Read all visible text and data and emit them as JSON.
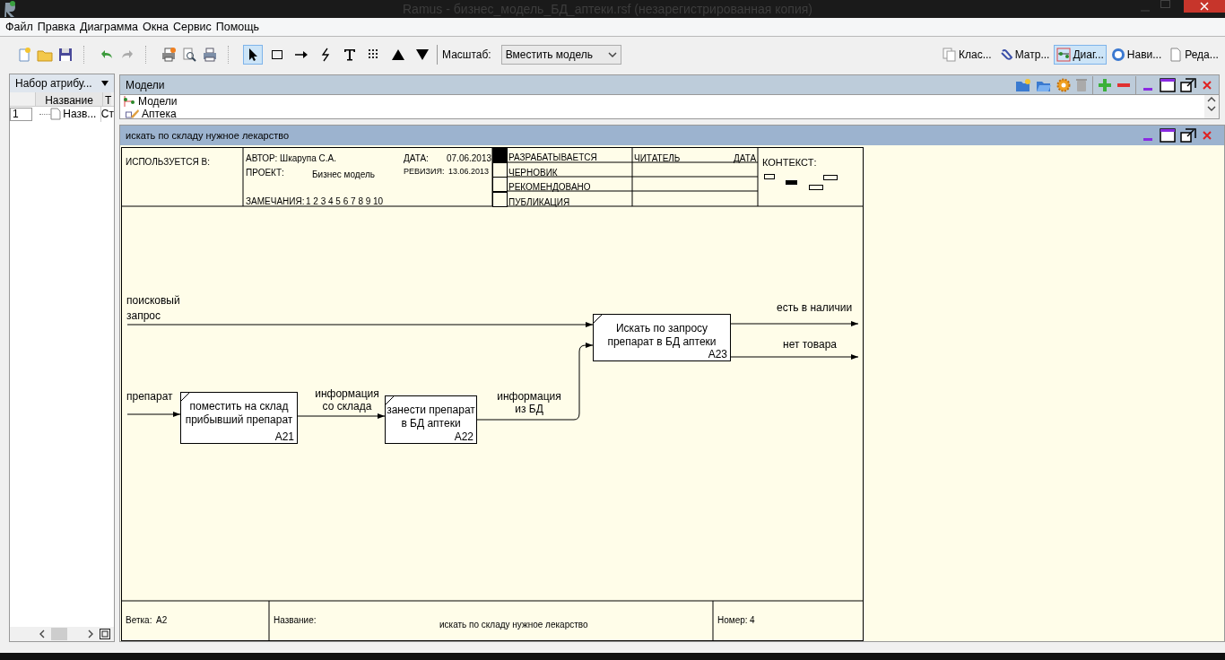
{
  "window": {
    "title": "Ramus - бизнес_модель_БД_аптеки.rsf (незарегистрированная копия)"
  },
  "menu": [
    "Файл",
    "Правка",
    "Диаграмма",
    "Окна",
    "Сервис",
    "Помощь"
  ],
  "toolbar": {
    "file_tools": [
      {
        "kind": "new"
      },
      {
        "kind": "open"
      },
      {
        "kind": "save"
      },
      {
        "kind": "undo"
      },
      {
        "kind": "redo"
      },
      {
        "kind": "print"
      },
      {
        "kind": "preview"
      },
      {
        "kind": "printer"
      }
    ],
    "draw_tools": [
      {
        "kind": "pointer",
        "selected": true
      },
      {
        "kind": "box",
        "selected": false
      },
      {
        "kind": "arrow",
        "selected": false
      },
      {
        "kind": "squiggle",
        "selected": false
      },
      {
        "kind": "text",
        "selected": false
      },
      {
        "kind": "dots",
        "selected": false
      },
      {
        "kind": "up",
        "selected": false
      },
      {
        "kind": "down",
        "selected": false
      }
    ],
    "scale_label": "Масштаб:",
    "scale_value": "Вместить модель",
    "views": [
      {
        "label": "Клас...",
        "kind": "pages",
        "selected": false
      },
      {
        "label": "Матр...",
        "kind": "clip",
        "selected": false
      },
      {
        "label": "Диаг...",
        "kind": "diagram",
        "selected": true
      },
      {
        "label": "Нави...",
        "kind": "globe",
        "selected": false
      },
      {
        "label": "Реда...",
        "kind": "page",
        "selected": false
      }
    ]
  },
  "attributes_panel": {
    "title": "Набор атрибу...",
    "columns": [
      "Название",
      "Т"
    ],
    "rows": [
      {
        "number": "1",
        "name": "Назв...",
        "type": "Ст"
      }
    ]
  },
  "models_panel": {
    "title": "Модели",
    "tree": [
      {
        "label": "Модели",
        "kind": "root"
      },
      {
        "label": "Аптека",
        "kind": "model"
      }
    ]
  },
  "diagram_window": {
    "title": "искать по складу нужное лекарство"
  },
  "header": {
    "used_in": "ИСПОЛЬЗУЕТСЯ В:",
    "author_label": "АВТОР:",
    "author": "Шкарупа С.А.",
    "project_label": "ПРОЕКТ:",
    "project": "Бизнес модель",
    "date_label": "ДАТА:",
    "date": "07.06.2013",
    "revision_label": "РЕВИЗИЯ:",
    "revision": "13.06.2013",
    "notes_label": "ЗАМЕЧАНИЯ:",
    "notes": "1  2  3  4  5  6  7  8  9  10",
    "statuses": [
      {
        "label": "РАЗРАБАТЫВАЕТСЯ",
        "selected": true
      },
      {
        "label": "ЧЕРНОВИК",
        "selected": false
      },
      {
        "label": "РЕКОМЕНДОВАНО",
        "selected": false
      },
      {
        "label": "ПУБЛИКАЦИЯ",
        "selected": false
      }
    ],
    "reader_label": "ЧИТАТЕЛЬ",
    "reader_date_label": "ДАТА",
    "context_label": "КОНТЕКСТ:"
  },
  "activities": [
    {
      "name": "поместить на склад прибывший препарат",
      "number": "A21"
    },
    {
      "name": "занести препарат в БД аптеки",
      "number": "A22"
    },
    {
      "name": "Искать по запросу препарат в БД аптеки",
      "number": "A23"
    }
  ],
  "arrows": [
    {
      "label": "поисковый запрос"
    },
    {
      "label": "препарат"
    },
    {
      "label": "информация со склада"
    },
    {
      "label": "информация из БД"
    },
    {
      "label": "есть в наличии"
    },
    {
      "label": "нет товара"
    }
  ],
  "footer": {
    "node_label": "Ветка:",
    "node": "A2",
    "title_label": "Название:",
    "title": "искать по складу нужное лекарство",
    "number_label": "Номер:",
    "number": "4"
  }
}
